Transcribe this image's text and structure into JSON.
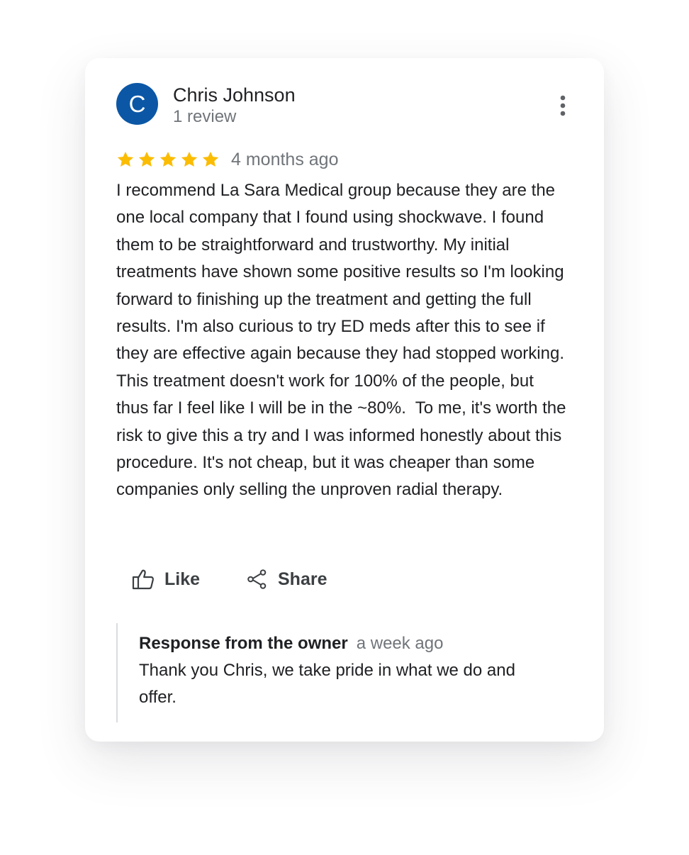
{
  "review": {
    "author_initial": "C",
    "author_name": "Chris Johnson",
    "review_count": "1 review",
    "rating": 5,
    "rating_max": 5,
    "star_color": "#fbbc04",
    "date": "4 months ago",
    "text": "I recommend La Sara Medical group because they are the one local company that I found using shockwave. I found them to be straightforward and trustworthy. My initial treatments have shown some positive results so I'm looking forward to finishing up the treatment and getting the full results. I'm also curious to try ED meds after this to see if they are effective again because they had stopped working. This treatment doesn't work for 100% of the people, but thus far I feel like I will be in the ~80%.  To me, it's worth the risk to give this a try and I was informed honestly about this procedure. It's not cheap, but it was cheaper than some companies only selling the unproven radial therapy."
  },
  "actions": {
    "like_label": "Like",
    "like_icon": "thumbs-up-icon",
    "share_label": "Share",
    "share_icon": "share-icon",
    "more_icon": "more-vertical-icon"
  },
  "owner_response": {
    "title": "Response from the owner",
    "date": "a week ago",
    "text": "Thank you Chris, we take pride in what we do and offer."
  },
  "colors": {
    "avatar_bg": "#0b57a6",
    "primary_text": "#202124",
    "secondary_text": "#70757a"
  }
}
